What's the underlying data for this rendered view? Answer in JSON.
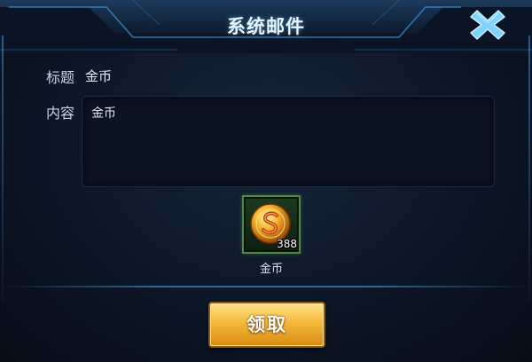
{
  "dialog": {
    "title": "系统邮件",
    "close_icon": "close-x-icon",
    "accent_color": "#3fb8ff"
  },
  "mail": {
    "subject_label": "标题",
    "subject_value": "金币",
    "content_label": "内容",
    "content_text": "金币"
  },
  "attachment": {
    "icon": "gold-coin-icon",
    "count": "388",
    "name": "金币"
  },
  "actions": {
    "claim_label": "领取",
    "claim_color": "#f4b83a"
  }
}
